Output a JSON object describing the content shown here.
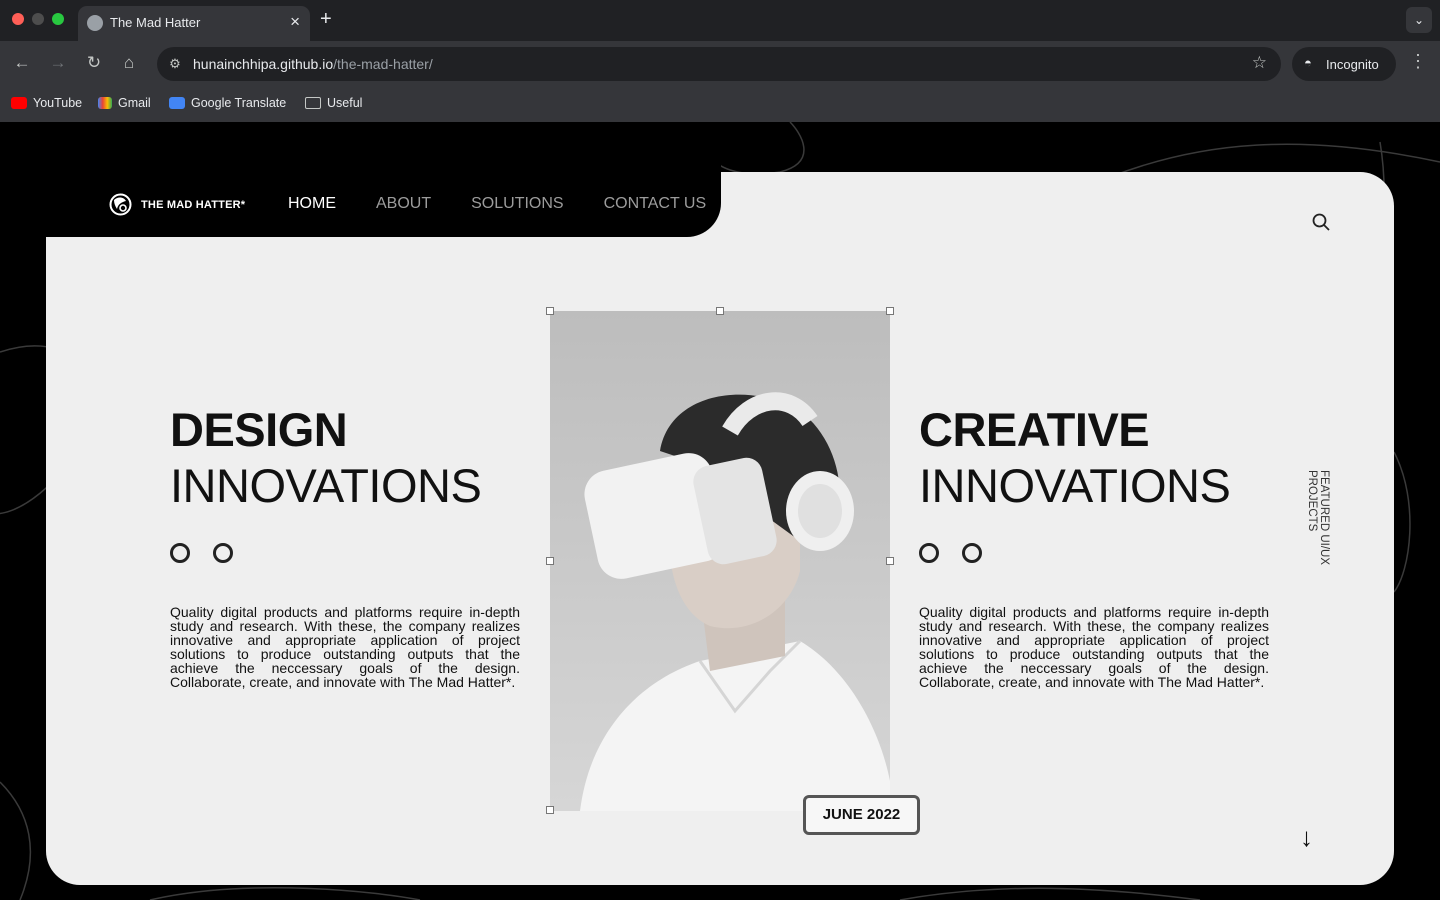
{
  "browser": {
    "tab_title": "The Mad Hatter",
    "url_domain": "hunainchhipa.github.io",
    "url_path": "/the-mad-hatter/",
    "incognito_label": "Incognito",
    "bookmarks": [
      "YouTube",
      "Gmail",
      "Google Translate",
      "Useful"
    ]
  },
  "site": {
    "logo_text": "THE MAD HATTER*",
    "nav": [
      "HOME",
      "ABOUT",
      "SOLUTIONS",
      "CONTACT US"
    ],
    "active_nav": "HOME",
    "left": {
      "heading_bold": "DESIGN",
      "heading_light": "INNOVATIONS",
      "paragraph": "Quality digital products and platforms require in-depth study and research. With these, the company realizes innovative and appropriate application of project solutions to produce outstanding outputs that the achieve the neccessary goals of the design. Collaborate, create, and innovate with The Mad Hatter*."
    },
    "right": {
      "heading_bold": "CREATIVE",
      "heading_light": "INNOVATIONS",
      "paragraph": "Quality digital products and platforms require in-depth study and research. With these, the company realizes innovative and appropriate application of project solutions to produce outstanding outputs that the achieve the neccessary goals of the design. Collaborate, create, and innovate with The Mad Hatter*."
    },
    "date_badge": "JUNE 2022",
    "vertical_label": "FEATURED UI/UX PROJECTS"
  },
  "icons": {
    "search": "search-icon",
    "arrow": "arrow-down-icon"
  }
}
